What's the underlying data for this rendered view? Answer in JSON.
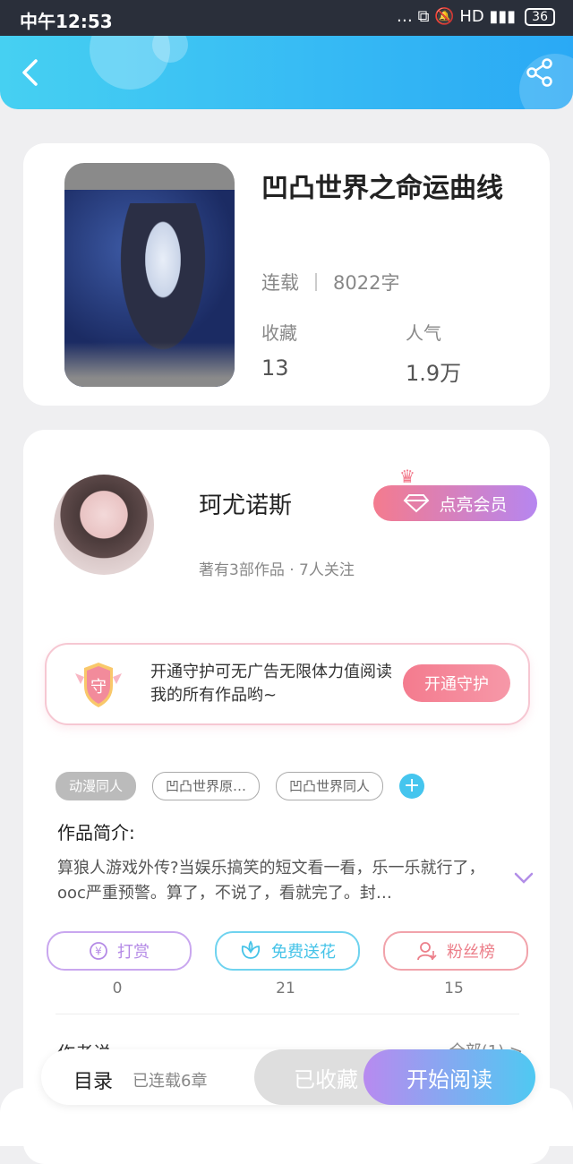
{
  "status_bar": {
    "time": "中午12:53",
    "icons": "… ⧉ 🔕 HD ▮▮▮ ",
    "battery": "36"
  },
  "header": {
    "back_icon": "chevron-left-icon",
    "share_icon": "share-icon"
  },
  "book": {
    "title": "凹凸世界之命运曲线",
    "status": "连载",
    "word_count": "8022字",
    "stats": [
      {
        "label": "收藏",
        "value": "13"
      },
      {
        "label": "人气",
        "value": "1.9万"
      }
    ]
  },
  "author": {
    "name": "珂尤诺斯",
    "subtitle": "著有3部作品 · 7人关注",
    "vip_label": "点亮会员"
  },
  "guard": {
    "badge_text": "守",
    "text": "开通守护可无广告无限体力值阅读我的所有作品哟~",
    "button_label": "开通守护"
  },
  "tags": [
    "动漫同人",
    "凹凸世界原…",
    "凹凸世界同人"
  ],
  "intro": {
    "label": "作品简介:",
    "text": "算狼人游戏外传?当娱乐搞笑的短文看一看，乐一乐就行了，ooc严重预警。算了，不说了，看就完了。封…"
  },
  "actions": [
    {
      "label": "打赏",
      "count": "0",
      "icon": "yen-icon",
      "color": "#b48ae6"
    },
    {
      "label": "免费送花",
      "count": "21",
      "icon": "flower-icon",
      "color": "#45c3e8"
    },
    {
      "label": "粉丝榜",
      "count": "15",
      "icon": "user-rank-icon",
      "color": "#ec7f8a"
    }
  ],
  "author_words": {
    "label": "作者说",
    "link": "全部(1) >"
  },
  "bottom_bar": {
    "toc": "目录",
    "serial": "已连载6章",
    "collected": "已收藏",
    "read": "开始阅读"
  }
}
